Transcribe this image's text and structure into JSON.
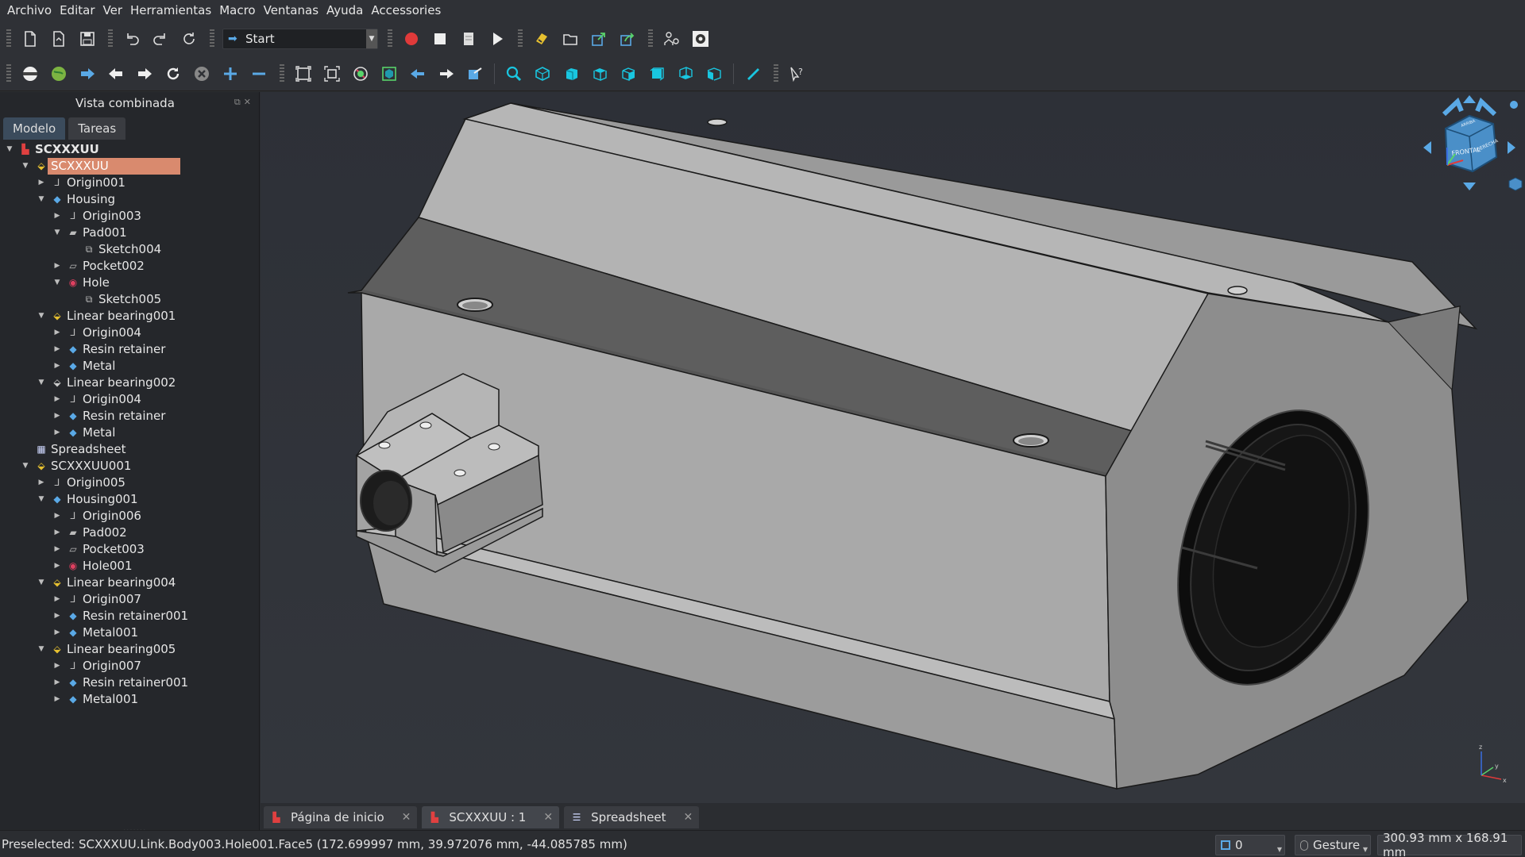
{
  "menu": [
    "Archivo",
    "Editar",
    "Ver",
    "Herramientas",
    "Macro",
    "Ventanas",
    "Ayuda",
    "Accessories"
  ],
  "workbench": {
    "label": "Start"
  },
  "panel": {
    "title": "Vista combinada",
    "tabs": [
      "Modelo",
      "Tareas"
    ]
  },
  "tree": [
    {
      "label": "SCXXXUU",
      "level": 0,
      "arrow": "down",
      "icon": "document-icon",
      "color": "#e04040",
      "bold": true
    },
    {
      "label": "SCXXXUU",
      "level": 1,
      "arrow": "down",
      "icon": "link-icon",
      "color": "#e6c030",
      "selected": true
    },
    {
      "label": "Origin001",
      "level": 2,
      "arrow": "right",
      "icon": "origin-icon",
      "color": "#bbbbbb"
    },
    {
      "label": "Housing",
      "level": 2,
      "arrow": "down",
      "icon": "body-icon",
      "color": "#5aa9e6"
    },
    {
      "label": "Origin003",
      "level": 3,
      "arrow": "right",
      "icon": "origin-icon",
      "color": "#bbbbbb"
    },
    {
      "label": "Pad001",
      "level": 3,
      "arrow": "down",
      "icon": "pad-icon",
      "color": "#bbbbbb"
    },
    {
      "label": "Sketch004",
      "level": 4,
      "arrow": "",
      "icon": "sketch-icon",
      "color": "#bbbbbb"
    },
    {
      "label": "Pocket002",
      "level": 3,
      "arrow": "right",
      "icon": "pocket-icon",
      "color": "#bbbbbb"
    },
    {
      "label": "Hole",
      "level": 3,
      "arrow": "down",
      "icon": "hole-icon",
      "color": "#e04060"
    },
    {
      "label": "Sketch005",
      "level": 4,
      "arrow": "",
      "icon": "sketch-icon",
      "color": "#bbbbbb"
    },
    {
      "label": "Linear bearing001",
      "level": 2,
      "arrow": "down",
      "icon": "link-icon",
      "color": "#e6c030"
    },
    {
      "label": "Origin004",
      "level": 3,
      "arrow": "right",
      "icon": "origin-icon",
      "color": "#bbbbbb"
    },
    {
      "label": "Resin retainer",
      "level": 3,
      "arrow": "right",
      "icon": "body-icon",
      "color": "#5aa9e6"
    },
    {
      "label": "Metal",
      "level": 3,
      "arrow": "right",
      "icon": "body-icon",
      "color": "#5aa9e6"
    },
    {
      "label": "Linear bearing002",
      "level": 2,
      "arrow": "down",
      "icon": "link-icon",
      "color": "#cccccc"
    },
    {
      "label": "Origin004",
      "level": 3,
      "arrow": "right",
      "icon": "origin-icon",
      "color": "#bbbbbb"
    },
    {
      "label": "Resin retainer",
      "level": 3,
      "arrow": "right",
      "icon": "body-icon",
      "color": "#5aa9e6"
    },
    {
      "label": "Metal",
      "level": 3,
      "arrow": "right",
      "icon": "body-icon",
      "color": "#5aa9e6"
    },
    {
      "label": "Spreadsheet",
      "level": 1,
      "arrow": "",
      "icon": "spreadsheet-icon",
      "color": "#cfd8ff"
    },
    {
      "label": "SCXXXUU001",
      "level": 1,
      "arrow": "down",
      "icon": "link-icon",
      "color": "#e6c030"
    },
    {
      "label": "Origin005",
      "level": 2,
      "arrow": "right",
      "icon": "origin-icon",
      "color": "#bbbbbb"
    },
    {
      "label": "Housing001",
      "level": 2,
      "arrow": "down",
      "icon": "body-icon",
      "color": "#5aa9e6"
    },
    {
      "label": "Origin006",
      "level": 3,
      "arrow": "right",
      "icon": "origin-icon",
      "color": "#bbbbbb"
    },
    {
      "label": "Pad002",
      "level": 3,
      "arrow": "right",
      "icon": "pad-icon",
      "color": "#bbbbbb"
    },
    {
      "label": "Pocket003",
      "level": 3,
      "arrow": "right",
      "icon": "pocket-icon",
      "color": "#bbbbbb"
    },
    {
      "label": "Hole001",
      "level": 3,
      "arrow": "right",
      "icon": "hole-icon",
      "color": "#e04060"
    },
    {
      "label": "Linear bearing004",
      "level": 2,
      "arrow": "down",
      "icon": "link-icon",
      "color": "#e6c030"
    },
    {
      "label": "Origin007",
      "level": 3,
      "arrow": "right",
      "icon": "origin-icon",
      "color": "#bbbbbb"
    },
    {
      "label": "Resin retainer001",
      "level": 3,
      "arrow": "right",
      "icon": "body-icon",
      "color": "#5aa9e6"
    },
    {
      "label": "Metal001",
      "level": 3,
      "arrow": "right",
      "icon": "body-icon",
      "color": "#5aa9e6"
    },
    {
      "label": "Linear bearing005",
      "level": 2,
      "arrow": "down",
      "icon": "link-icon",
      "color": "#e6c030"
    },
    {
      "label": "Origin007",
      "level": 3,
      "arrow": "right",
      "icon": "origin-icon",
      "color": "#bbbbbb"
    },
    {
      "label": "Resin retainer001",
      "level": 3,
      "arrow": "right",
      "icon": "body-icon",
      "color": "#5aa9e6"
    },
    {
      "label": "Metal001",
      "level": 3,
      "arrow": "right",
      "icon": "body-icon",
      "color": "#5aa9e6"
    }
  ],
  "navcube": {
    "front_label": "FRONTAL",
    "right_label": "DERECHA",
    "top_label": "ARRIBA"
  },
  "doc_tabs": [
    {
      "label": "Página de inicio",
      "icon": "freecad-icon",
      "active": false
    },
    {
      "label": "SCXXXUU : 1",
      "icon": "freecad-icon",
      "active": true
    },
    {
      "label": "Spreadsheet",
      "icon": "spreadsheet-icon",
      "active": false
    }
  ],
  "status": {
    "message": "Preselected: SCXXXUU.Link.Body003.Hole001.Face5 (172.699997 mm, 39.972076 mm, -44.085785 mm)",
    "counter": "0",
    "nav_style": "Gesture",
    "dimensions": "300.93 mm x 168.91 mm"
  },
  "colors": {
    "accent": "#5aa9e6",
    "selection": "#d98a6e",
    "record": "#e03a3a",
    "toolbar_cyan": "#19c6e0"
  }
}
